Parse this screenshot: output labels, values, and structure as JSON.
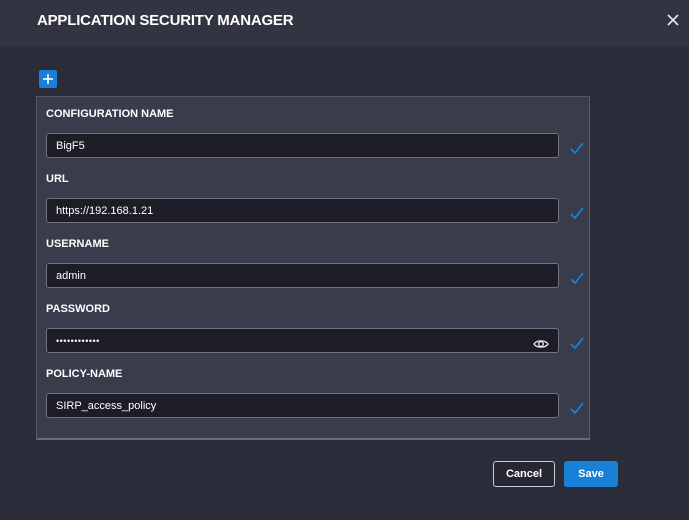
{
  "dialog": {
    "title": "APPLICATION SECURITY MANAGER",
    "close_icon": "close-icon",
    "add_icon": "plus-icon"
  },
  "fields": {
    "configuration_name": {
      "label": "CONFIGURATION NAME",
      "value": "BigF5",
      "valid": true
    },
    "url": {
      "label": "URL",
      "value": "https://192.168.1.21",
      "valid": true
    },
    "username": {
      "label": "USERNAME",
      "value": "admin",
      "valid": true
    },
    "password": {
      "label": "PASSWORD",
      "value": "••••••••••••",
      "valid": true,
      "toggle_icon": "eye-icon"
    },
    "policy_name": {
      "label": "POLICY-NAME",
      "value": "SIRP_access_policy",
      "valid": true
    }
  },
  "footer": {
    "cancel_label": "Cancel",
    "save_label": "Save"
  },
  "colors": {
    "accent": "#1a7fd6",
    "background": "#2b2c39",
    "panel": "#3a3b4b",
    "input": "#1c1d27"
  }
}
